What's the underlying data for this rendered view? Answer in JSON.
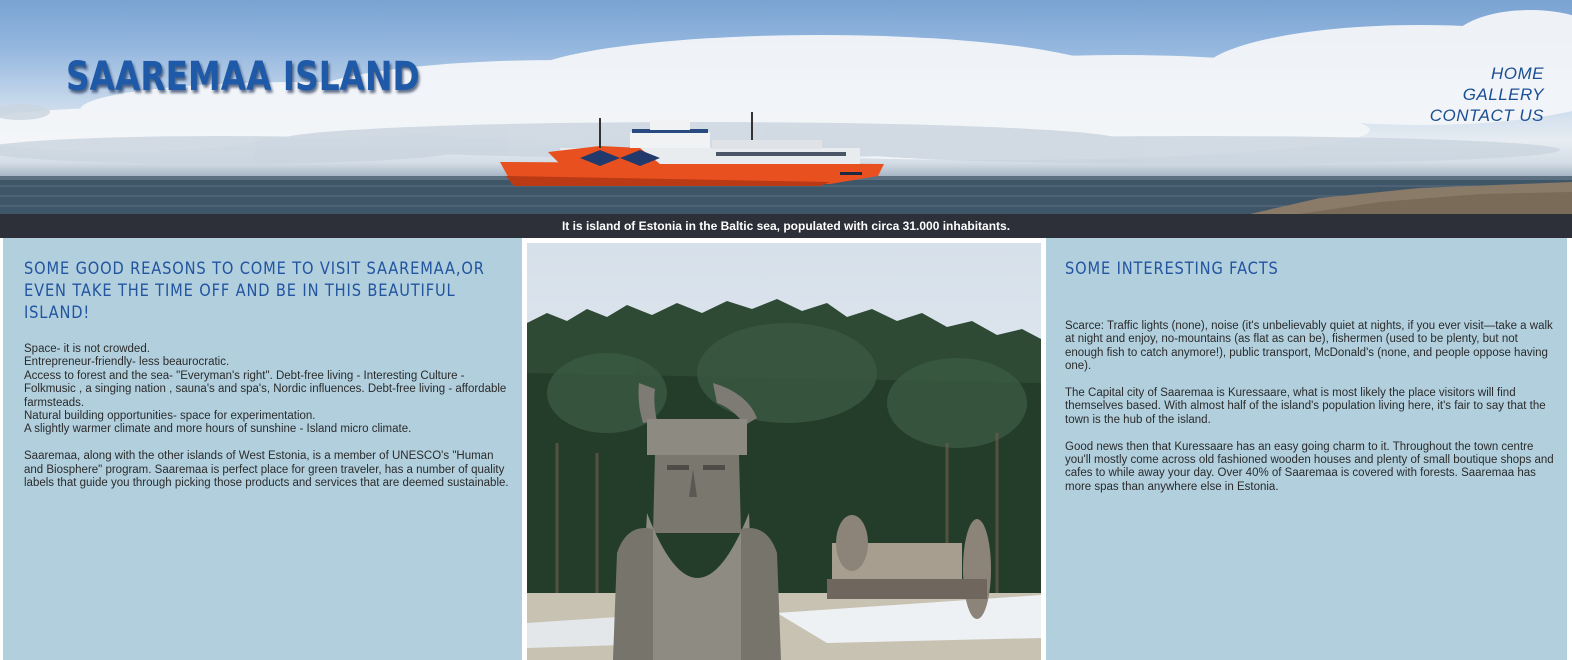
{
  "header": {
    "title": "SAAREMAA ISLAND",
    "hero_image": "ferry-at-sea-photo",
    "nav": [
      {
        "label": "HOME"
      },
      {
        "label": "GALLERY"
      },
      {
        "label": "CONTACT US"
      }
    ]
  },
  "tagline": "It is island of Estonia in the Baltic sea, populated with circa 31.000 inhabitants.",
  "left": {
    "heading": "SOME GOOD REASONS TO COME TO VISIT SAAREMAA,OR EVEN TAKE THE TIME OFF AND BE IN THIS BEAUTIFUL ISLAND!",
    "lines": [
      "Space- it is not crowded.",
      "Entrepreneur-friendly- less beaurocratic.",
      "Access to forest and the sea- \"Everyman's right\". Debt-free living - Interesting Culture - Folkmusic , a singing nation , sauna's and spa's, Nordic influences. Debt-free living - affordable farmsteads.",
      "Natural building opportunities- space for experimentation.",
      "A slightly warmer climate and more hours of sunshine - Island micro climate."
    ],
    "paragraph": "Saaremaa, along with the other islands of West Estonia, is a member of UNESCO's \"Human and Biosphere\" program. Saaremaa is perfect place for green traveler, has a number of quality labels that guide you through picking those products and services that are deemed sustainable."
  },
  "center": {
    "image": "wooden-viking-statue-photo"
  },
  "right": {
    "heading": "SOME INTERESTING FACTS",
    "paragraphs": [
      "Scarce: Traffic lights (none), noise (it's unbelievably quiet at nights, if you ever visit—take a walk at night and enjoy, no-mountains (as flat as can be), fishermen (used to be plenty, but not enough fish to catch anymore!), public transport, McDonald's (none, and people oppose having one).",
      "The Capital city of Saaremaa is Kuressaare, what is most likely the place visitors will find themselves based. With almost half of the island's population living here, it's fair to say that the town is the hub of the island.",
      "Good news then that Kuressaare has an easy going charm to it. Throughout the town centre you'll mostly come across old fashioned wooden houses and plenty of small boutique shops and cafes to while away your day. Over 40% of Saaremaa is covered with forests. Saaremaa has more spas than anywhere else in Estonia."
    ]
  },
  "colors": {
    "title": "#1e5aa7",
    "nav": "#1b4f93",
    "tagline_bg": "#2d3039",
    "panel_bg": "#b1cfdd",
    "heading": "#2254a0"
  }
}
